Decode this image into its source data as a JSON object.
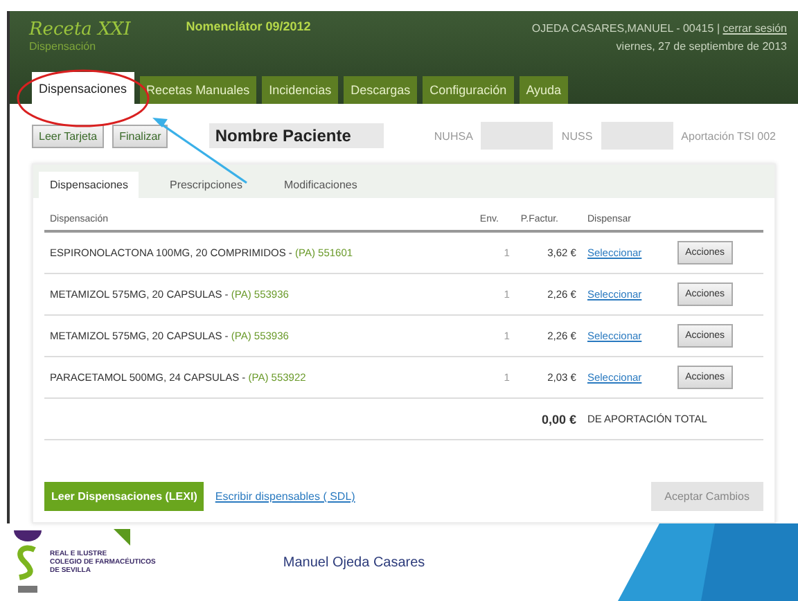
{
  "header": {
    "logo": "Receta XXI",
    "subtitle": "Dispensación",
    "nomenclator": "Nomenclátor 09/2012",
    "user": "OJEDA CASARES,MANUEL - 00415",
    "separator": "|",
    "logout": "cerrar sesión",
    "date": "viernes, 27 de septiembre de 2013"
  },
  "tabs": [
    {
      "label": "Dispensaciones",
      "selected": true
    },
    {
      "label": "Recetas Manuales",
      "selected": false
    },
    {
      "label": "Incidencias",
      "selected": false
    },
    {
      "label": "Descargas",
      "selected": false
    },
    {
      "label": "Configuración",
      "selected": false
    },
    {
      "label": "Ayuda",
      "selected": false
    }
  ],
  "patient_bar": {
    "buttons": [
      "Leer Tarjeta",
      "Finalizar"
    ],
    "patient_name": "Nombre Paciente",
    "nuhsa_label": "NUHSA",
    "nuss_label": "NUSS",
    "contribution": "Aportación TSI 002"
  },
  "sub_tabs": [
    {
      "label": "Dispensaciones",
      "selected": true
    },
    {
      "label": "Prescripciones",
      "selected": false
    },
    {
      "label": "Modificaciones",
      "selected": false
    }
  ],
  "table": {
    "columns": [
      "Dispensación",
      "Env.",
      "P.Factur.",
      "Dispensar"
    ],
    "rows": [
      {
        "name": "ESPIRONOLACTONA 100MG, 20 COMPRIMIDOS - ",
        "code": "(PA) 551601",
        "units": "1",
        "price": "3,62 €",
        "link": "Seleccionar",
        "action": "Acciones"
      },
      {
        "name": "METAMIZOL 575MG, 20 CAPSULAS - ",
        "code": "(PA) 553936",
        "units": "1",
        "price": "2,26 €",
        "link": "Seleccionar",
        "action": "Acciones"
      },
      {
        "name": "METAMIZOL 575MG, 20 CAPSULAS - ",
        "code": "(PA) 553936",
        "units": "1",
        "price": "2,26 €",
        "link": "Seleccionar",
        "action": "Acciones"
      },
      {
        "name": "PARACETAMOL 500MG, 24 CAPSULAS - ",
        "code": "(PA) 553922",
        "units": "1",
        "price": "2,03 €",
        "link": "Seleccionar",
        "action": "Acciones"
      }
    ],
    "total": "0,00 €",
    "total_label": "DE APORTACIÓN TOTAL"
  },
  "actions": {
    "primary": "Leer Dispensaciones (LEXI)",
    "link": "Escribir dispensables ( SDL)",
    "secondary": {
      "label": "Aceptar Cambios",
      "disabled": true
    }
  },
  "footer": {
    "org_lines": [
      "REAL E ILUSTRE",
      "COLEGIO DE FARMACÉUTICOS",
      "DE SEVILLA"
    ],
    "author": "Manuel Ojeda Casares"
  }
}
